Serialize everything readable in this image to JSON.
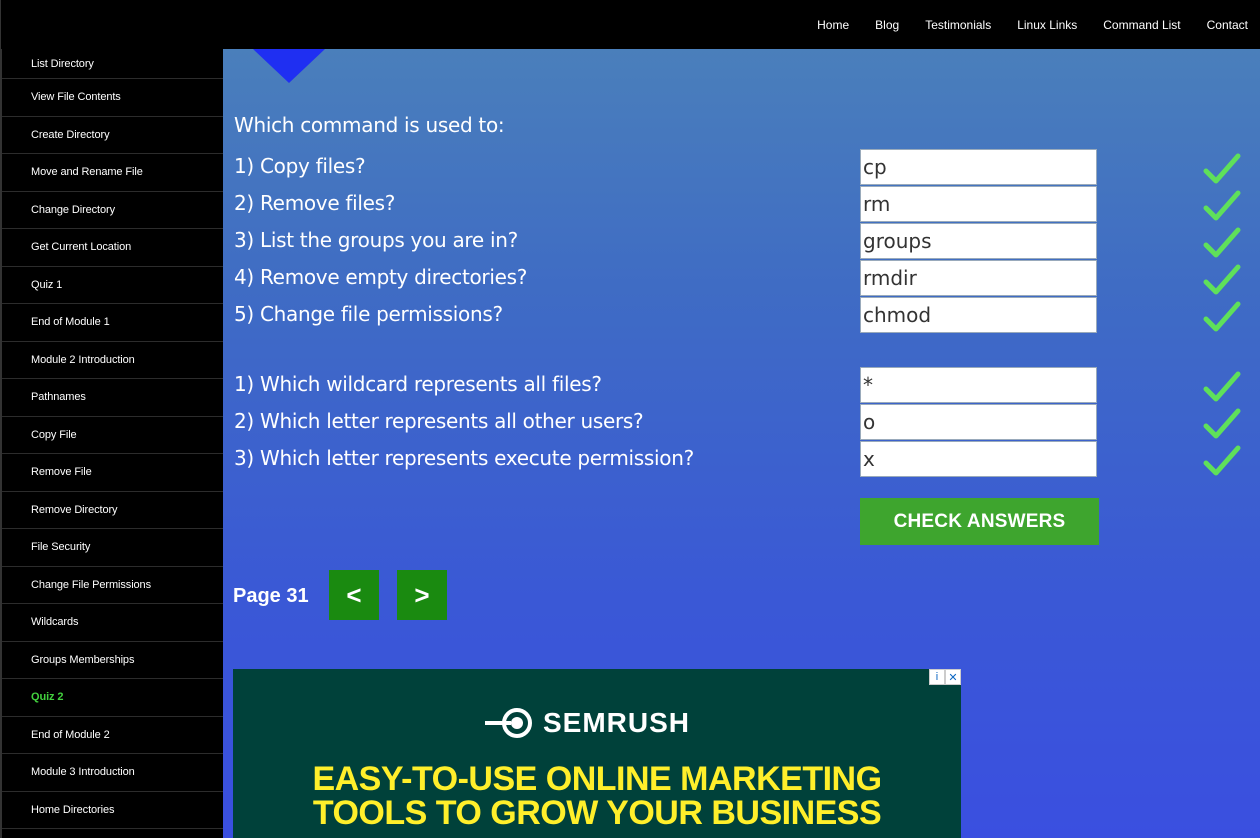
{
  "topnav": [
    "Home",
    "Blog",
    "Testimonials",
    "Linux Links",
    "Command List",
    "Contact"
  ],
  "sidebar": [
    {
      "label": "List Directory",
      "active": false
    },
    {
      "label": "View File Contents",
      "active": false
    },
    {
      "label": "Create Directory",
      "active": false
    },
    {
      "label": "Move and Rename File",
      "active": false
    },
    {
      "label": "Change Directory",
      "active": false
    },
    {
      "label": "Get Current Location",
      "active": false
    },
    {
      "label": "Quiz 1",
      "active": false
    },
    {
      "label": "End of Module 1",
      "active": false
    },
    {
      "label": "Module 2 Introduction",
      "active": false
    },
    {
      "label": "Pathnames",
      "active": false
    },
    {
      "label": "Copy File",
      "active": false
    },
    {
      "label": "Remove File",
      "active": false
    },
    {
      "label": "Remove Directory",
      "active": false
    },
    {
      "label": "File Security",
      "active": false
    },
    {
      "label": "Change File Permissions",
      "active": false
    },
    {
      "label": "Wildcards",
      "active": false
    },
    {
      "label": "Groups Memberships",
      "active": false
    },
    {
      "label": "Quiz 2",
      "active": true
    },
    {
      "label": "End of Module 2",
      "active": false
    },
    {
      "label": "Module 3 Introduction",
      "active": false
    },
    {
      "label": "Home Directories",
      "active": false
    }
  ],
  "quiz": {
    "intro": "Which command is used to:",
    "section1": [
      {
        "question": "1) Copy files?",
        "answer": "cp"
      },
      {
        "question": "2) Remove files?",
        "answer": "rm"
      },
      {
        "question": "3) List the groups you are in?",
        "answer": "groups"
      },
      {
        "question": "4) Remove empty directories?",
        "answer": "rmdir"
      },
      {
        "question": "5) Change file permissions?",
        "answer": "chmod"
      }
    ],
    "section2": [
      {
        "question": "1) Which wildcard represents all files?",
        "answer": "*"
      },
      {
        "question": "2) Which letter represents all other users?",
        "answer": "o"
      },
      {
        "question": "3) Which letter represents execute permission?",
        "answer": "x"
      }
    ],
    "check_label": "CHECK ANSWERS"
  },
  "pager": {
    "label": "Page 31",
    "prev": "<",
    "next": ">"
  },
  "ad": {
    "brand": "SEMRUSH",
    "headline_line1": "EASY-TO-USE ONLINE MARKETING",
    "headline_line2": "TOOLS TO GROW YOUR BUSINESS",
    "info_glyph": "i",
    "close_glyph": "✕"
  },
  "colors": {
    "accent_green": "#3ea52e",
    "check_green": "#5fe05a",
    "active_link": "#42d13e",
    "ad_text": "#ffef2b"
  }
}
